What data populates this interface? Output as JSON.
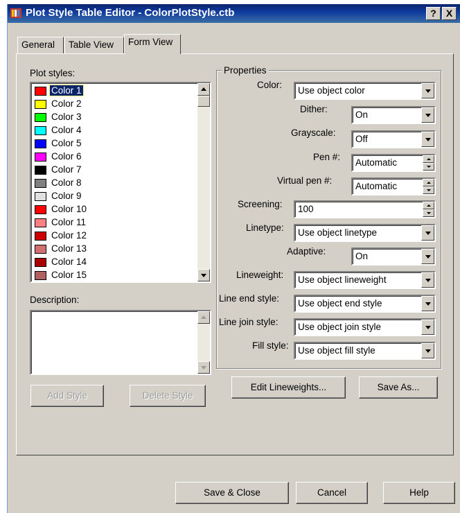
{
  "window": {
    "title": "Plot Style Table Editor - ColorPlotStyle.ctb",
    "help_button": "?",
    "close_button": "X"
  },
  "tabs": [
    {
      "label": "General"
    },
    {
      "label": "Table View"
    },
    {
      "label": "Form View",
      "active": true
    }
  ],
  "plot_styles": {
    "label": "Plot styles:",
    "items": [
      {
        "label": "Color 1",
        "color": "#ff0000",
        "selected": true
      },
      {
        "label": "Color 2",
        "color": "#ffff00"
      },
      {
        "label": "Color 3",
        "color": "#00ff00"
      },
      {
        "label": "Color 4",
        "color": "#00ffff"
      },
      {
        "label": "Color 5",
        "color": "#0000ff"
      },
      {
        "label": "Color 6",
        "color": "#ff00ff"
      },
      {
        "label": "Color 7",
        "color": "#000000"
      },
      {
        "label": "Color 8",
        "color": "#808080"
      },
      {
        "label": "Color 9",
        "color": "#e0e0e0"
      },
      {
        "label": "Color 10",
        "color": "#ff0000"
      },
      {
        "label": "Color 11",
        "color": "#ff8080"
      },
      {
        "label": "Color 12",
        "color": "#cc0000"
      },
      {
        "label": "Color 13",
        "color": "#d07070"
      },
      {
        "label": "Color 14",
        "color": "#aa0000"
      },
      {
        "label": "Color 15",
        "color": "#b06060"
      }
    ]
  },
  "description": {
    "label": "Description:",
    "value": ""
  },
  "buttons": {
    "add_style": "Add Style",
    "delete_style": "Delete Style",
    "edit_lineweights": "Edit Lineweights...",
    "save_as": "Save As...",
    "save_close": "Save & Close",
    "cancel": "Cancel",
    "help": "Help"
  },
  "properties": {
    "legend": "Properties",
    "color": {
      "label": "Color:",
      "value": "Use object color"
    },
    "dither": {
      "label": "Dither:",
      "value": "On"
    },
    "grayscale": {
      "label": "Grayscale:",
      "value": "Off"
    },
    "pen": {
      "label": "Pen #:",
      "value": "Automatic"
    },
    "virtual_pen": {
      "label": "Virtual pen #:",
      "value": "Automatic"
    },
    "screening": {
      "label": "Screening:",
      "value": "100"
    },
    "linetype": {
      "label": "Linetype:",
      "value": "Use object linetype"
    },
    "adaptive": {
      "label": "Adaptive:",
      "value": "On"
    },
    "lineweight": {
      "label": "Lineweight:",
      "value": "Use object lineweight"
    },
    "line_end_style": {
      "label": "Line end style:",
      "value": "Use object end style"
    },
    "line_join_style": {
      "label": "Line join style:",
      "value": "Use object join style"
    },
    "fill_style": {
      "label": "Fill style:",
      "value": "Use object fill style"
    }
  }
}
